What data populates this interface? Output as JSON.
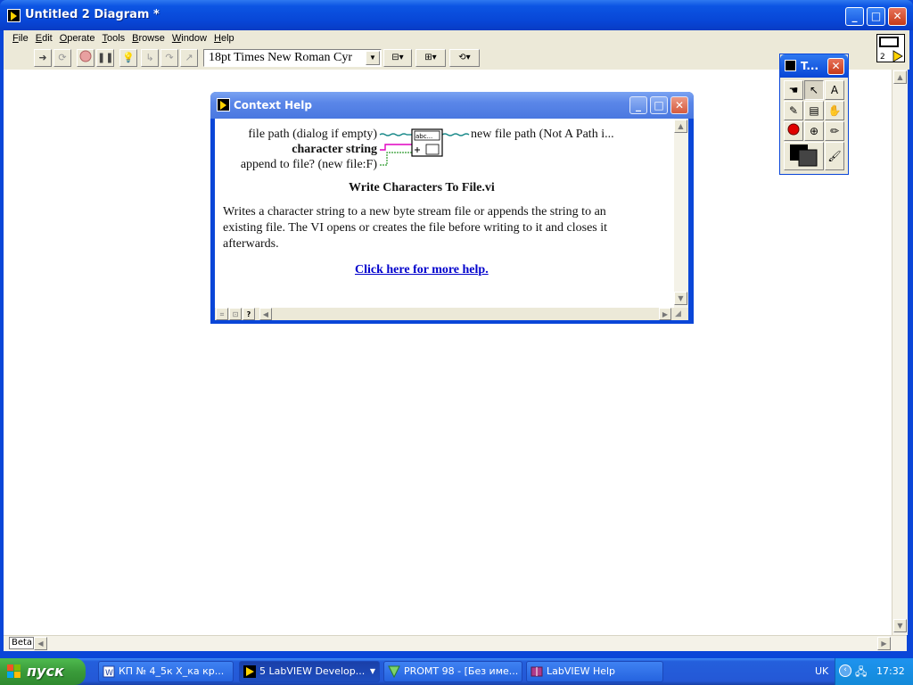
{
  "window": {
    "title": "Untitled 2 Diagram *",
    "minimize": "_",
    "maximize": "□",
    "close": "✕"
  },
  "menu": [
    "File",
    "Edit",
    "Operate",
    "Tools",
    "Browse",
    "Window",
    "Help"
  ],
  "toolbar": {
    "font": "18pt Times New Roman Cyr",
    "vi_icon_number": "2"
  },
  "status": {
    "beta": "Beta"
  },
  "tools_palette": {
    "title": "T..."
  },
  "context_help": {
    "title": "Context Help",
    "terminals": {
      "file_path": "file path (dialog if empty)",
      "character_string": "character string",
      "append": "append to file? (new file:F)",
      "new_file_path": "new file path (Not A Path i..."
    },
    "node_glyph": "abc...",
    "vi_name": "Write Characters To File.vi",
    "description": "Writes a character string to a new byte stream file or appends the string to an existing file. The VI opens or creates the file before writing to it and closes it afterwards.",
    "link": "Click here for more help."
  },
  "taskbar": {
    "start": "пуск",
    "tasks": [
      "КП № 4_5к Х_ка кр...",
      "5 LabVIEW Develop...",
      "PROMT 98 - [Без име...",
      "LabVIEW Help"
    ],
    "language": "UK",
    "clock": "17:32"
  },
  "colors": {
    "titlebar": "#0846d6",
    "face": "#ece9d8",
    "link": "#0000cc",
    "start": "#3a9b3a"
  }
}
